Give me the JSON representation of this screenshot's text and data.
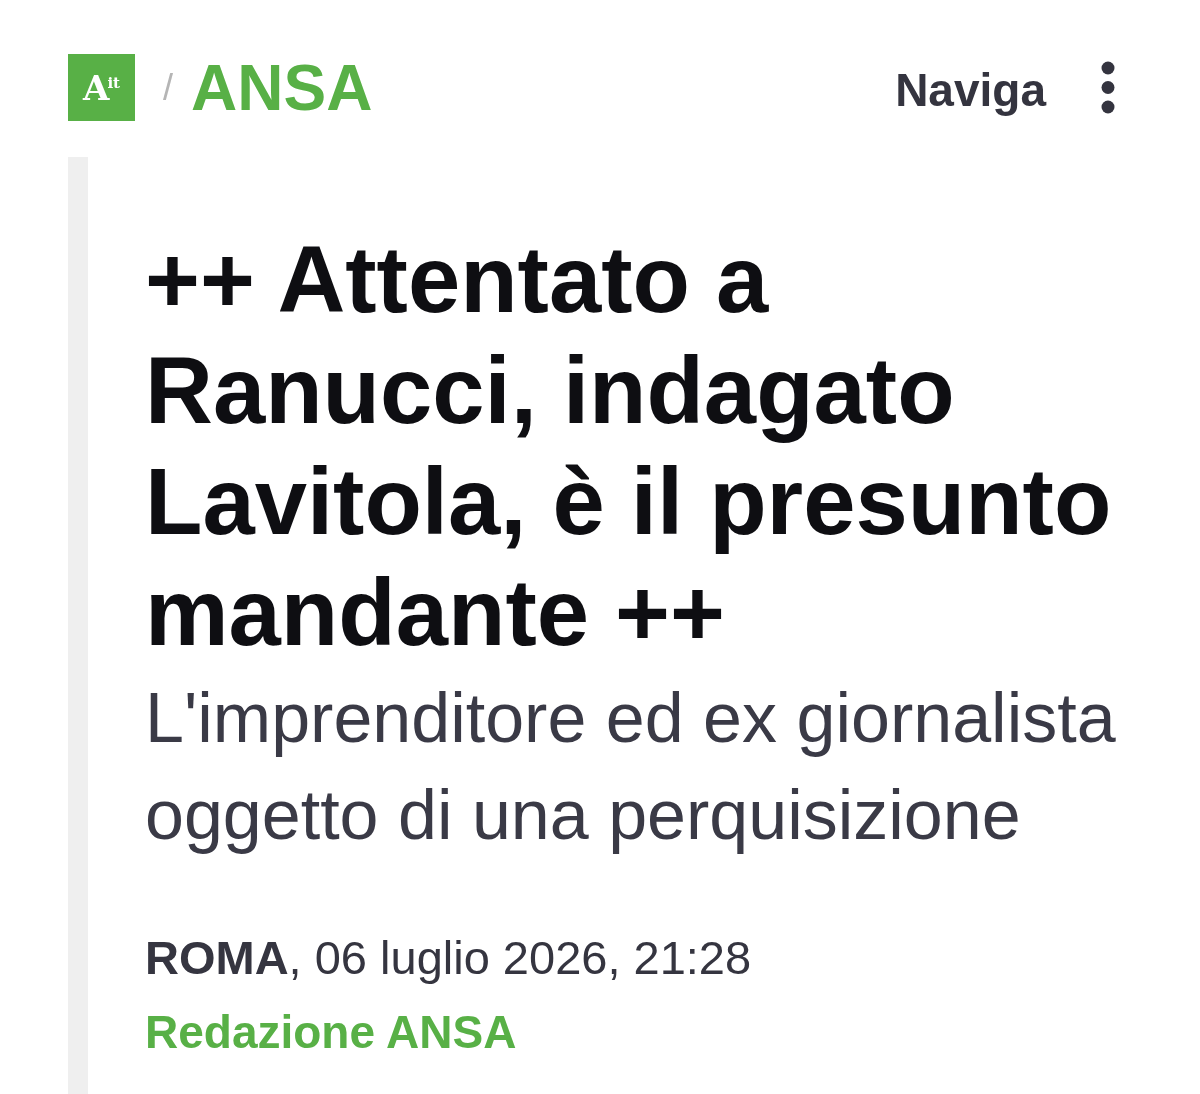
{
  "header": {
    "logo": {
      "letter": "A",
      "superscript": "it"
    },
    "separator": "/",
    "site_name": "ANSA",
    "nav_label": "Naviga"
  },
  "article": {
    "headline": "++ Attentato a Ranucci, indagato Lavitola, è il presunto mandante ++",
    "subheadline": "L'imprenditore ed ex giornalista oggetto di una perquisizione",
    "dateline": "**ROMA**, 06 luglio 2026, 21:28",
    "author": "Redazione ANSA"
  }
}
